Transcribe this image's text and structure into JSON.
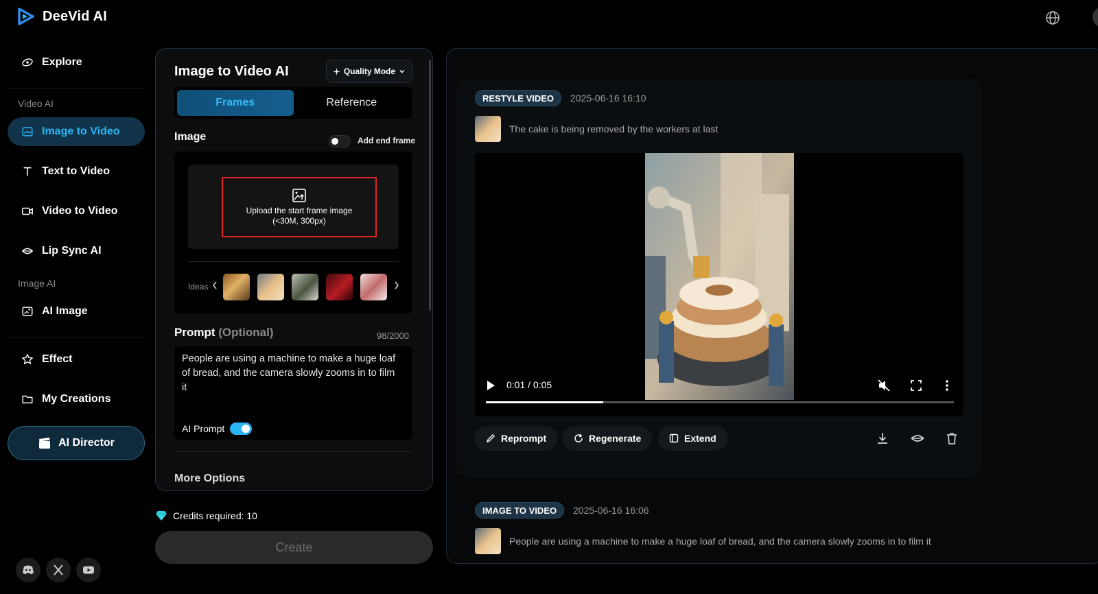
{
  "app": {
    "name": "DeeVid AI"
  },
  "sidebar": {
    "explore": "Explore",
    "section_video": "Video AI",
    "image_to_video": "Image to Video",
    "text_to_video": "Text to Video",
    "video_to_video": "Video to Video",
    "lip_sync": "Lip Sync AI",
    "section_image": "Image AI",
    "ai_image": "AI Image",
    "effect": "Effect",
    "my_creations": "My Creations",
    "ai_director": "AI Director",
    "social": [
      "discord",
      "x",
      "youtube"
    ]
  },
  "panel": {
    "title": "Image to Video AI",
    "quality_mode": "Quality Mode",
    "tabs": [
      "Frames",
      "Reference"
    ],
    "active_tab": "Frames",
    "image_label": "Image",
    "add_end_frame": "Add end frame",
    "add_end_frame_on": false,
    "upload_line1": "Upload the start frame image",
    "upload_line2": "(<30M, 300px)",
    "ideas_label": "Ideas",
    "prompt_label": "Prompt",
    "prompt_optional": "(Optional)",
    "prompt_counter": "98/2000",
    "prompt_text": "People are using a machine to make a huge loaf of bread, and the camera slowly zooms in to film it",
    "ai_prompt_label": "AI Prompt",
    "ai_prompt_on": true,
    "more_options": "More Options"
  },
  "credits": {
    "label": "Credits required: 10"
  },
  "create_button": "Create",
  "results": [
    {
      "badge": "RESTYLE VIDEO",
      "date": "2025-06-16 16:10",
      "description": "The cake is being removed by the workers at last",
      "player": {
        "time": "0:01 / 0:05",
        "progress": 0.25,
        "muted": true
      },
      "actions": [
        "Reprompt",
        "Regenerate",
        "Extend"
      ]
    },
    {
      "badge": "IMAGE TO VIDEO",
      "date": "2025-06-16 16:06",
      "description": "People are using a machine to make a huge loaf of bread, and the camera slowly zooms in to film it"
    }
  ],
  "colors": {
    "accent": "#2bb5f4",
    "active_bg": "#11344b",
    "upload_highlight": "#e02424"
  }
}
